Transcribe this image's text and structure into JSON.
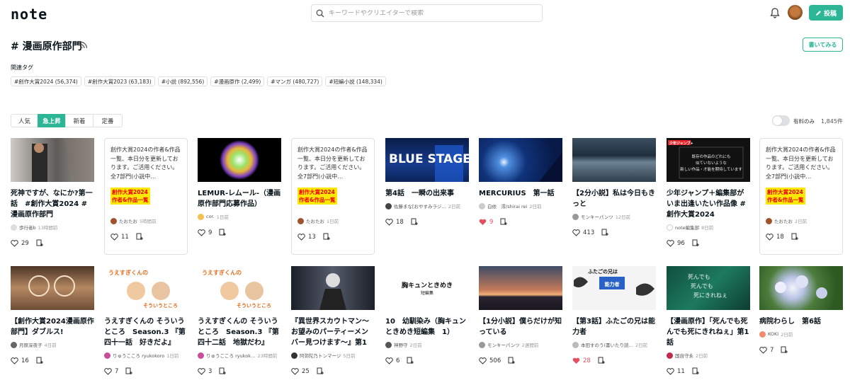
{
  "header": {
    "logo": "note",
    "search_placeholder": "キーワードやクリエイターで検索",
    "post_label": "投稿"
  },
  "page": {
    "title": "# 漫画原作部門",
    "write_label": "書いてみる",
    "related_label": "関連タグ",
    "tags": [
      "#創作大賞2024 (56,374)",
      "#創作大賞2023 (63,183)",
      "#小説 (892,556)",
      "#漫画原作 (2,499)",
      "#マンガ (480,727)",
      "#短編小説 (148,334)"
    ],
    "tabs": [
      "人気",
      "急上昇",
      "新着",
      "定番"
    ],
    "active_tab": "急上昇",
    "paid_only_label": "有料のみ",
    "count": "1,845件"
  },
  "colors": {
    "accent": "#2cb696",
    "like": "#e3505e",
    "highlight": "#ffe800"
  },
  "promo": {
    "text": "創作大賞2024の作者&作品一覧、本日分を更新しております。ご活用ください。全7部門(小説中…",
    "badge1": "創作大賞2024",
    "badge2": "作者&作品一覧"
  },
  "cards": [
    {
      "title": "死神ですが、なにか?第一話　#創作大賞2024 #漫画原作部門",
      "author": "歩行者b",
      "time": "13時間前",
      "likes": "29",
      "liked": false
    },
    {
      "title": "",
      "author": "たおたお",
      "time": "5時間前",
      "likes": "11",
      "liked": false,
      "promo": true
    },
    {
      "title": "LEMUR-レムール-（漫画原作部門応募作品）",
      "author": "cor.",
      "time": "1日前",
      "likes": "9",
      "liked": false
    },
    {
      "title": "",
      "author": "たおたお",
      "time": "1日前",
      "likes": "13",
      "liked": false,
      "promo": true
    },
    {
      "title": "第4話　一瞬の出来事",
      "author": "佐藤まな[おやすみラジ…",
      "time": "2日前",
      "likes": "18",
      "liked": false
    },
    {
      "title": "MERCURIUS　第一話",
      "author": "白依　澪/shirai rei",
      "time": "2日前",
      "likes": "9",
      "liked": true
    },
    {
      "title": "【2分小説】私は今日もきっと",
      "author": "モンキーパンツ",
      "time": "12日前",
      "likes": "413",
      "liked": false
    },
    {
      "title": "少年ジャンプ＋編集部がいま出逢いたい作品像 #創作大賞2024",
      "author": "note編集部",
      "time": "8日前",
      "likes": "96",
      "liked": false
    },
    {
      "title": "",
      "author": "たおたお",
      "time": "2日前",
      "likes": "18",
      "liked": false,
      "promo": true
    },
    {
      "title": "【創作大賞2024漫画原作部門】ダブルス!",
      "author": "月原深夜子",
      "time": "4日前",
      "likes": "16",
      "liked": false
    },
    {
      "title": "うえすぎくんの そういうところ　Season.3 『第四十一話　好きだよ』",
      "author": "りゅうこころ ryukokoro",
      "time": "1日前",
      "likes": "7",
      "liked": false
    },
    {
      "title": "うえすぎくんの そういうところ　Season.3 『第四十二話　地獄だわ』",
      "author": "りゅうこころ ryukok…",
      "time": "23時間前",
      "likes": "3",
      "liked": false
    },
    {
      "title": "『異世界スカウトマン〜お望みのパーティーメンバー見つけます〜』第1話…",
      "author": "阿弥陀乃トンマージ",
      "time": "5日前",
      "likes": "25",
      "liked": false
    },
    {
      "title": "10　幼馴染み（胸キュンときめき短編集　1）",
      "author": "神野守",
      "time": "2日前",
      "likes": "6",
      "liked": false
    },
    {
      "title": "【1分小説】僕らだけが知っている",
      "author": "モンキーパンツ",
      "time": "2週間前",
      "likes": "506",
      "liked": false
    },
    {
      "title": "【第3話】ふたごの兄は能力者",
      "author": "本田すのう(書いたり読…",
      "time": "2日前",
      "likes": "28",
      "liked": true
    },
    {
      "title": "【漫画原作】「死んでも死んでも死にきれねぇ」第1話",
      "author": "国自守永",
      "time": "2日前",
      "likes": "11",
      "liked": false
    },
    {
      "title": "病院わらし　第6話",
      "author": "KOKI",
      "time": "2日前",
      "likes": "7",
      "liked": false
    }
  ],
  "thumb_text": {
    "blue_stage": "BLUE STAGE",
    "jump": "少年ジャンプ+",
    "jump_lines": [
      "既存の作品のどれにも",
      "似ていないような",
      "新しい作品・才能を期待しています"
    ],
    "jump_side": "少年ジャンプ+",
    "mune": "胸キュンときめき",
    "mune_sub": "短編集",
    "futago": "ふたごの兄は",
    "futago_sub": "能力者",
    "shinde": [
      "死んでも",
      "死んでも",
      "死にきれねぇ"
    ],
    "uesugi": "うえすぎくんの",
    "uesugi_sub": "そういうところ"
  }
}
